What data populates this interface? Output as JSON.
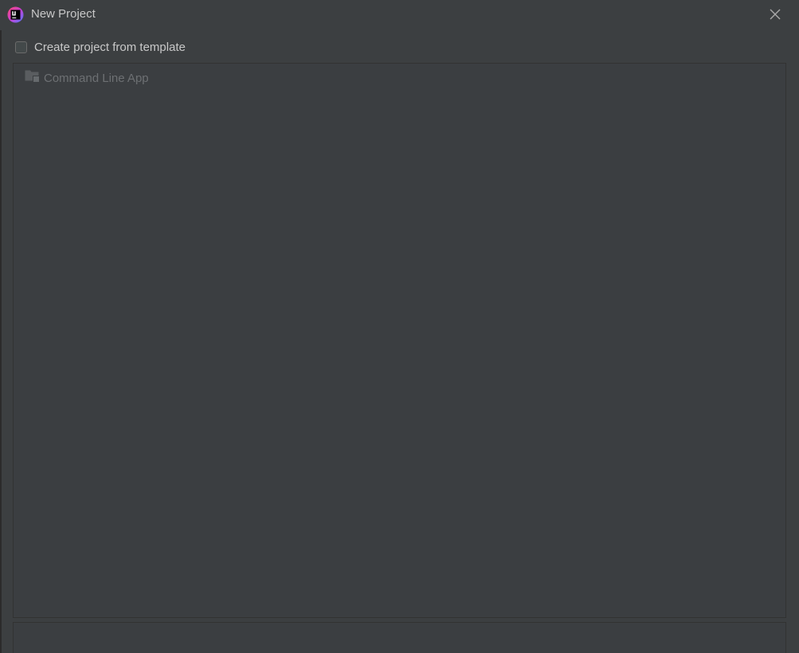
{
  "window": {
    "title": "New Project",
    "app_icon": "intellij-idea-icon",
    "close_icon": "close-icon"
  },
  "template_option": {
    "label": "Create project from template",
    "checked": false
  },
  "templates": {
    "items": [
      {
        "label": "Command Line App",
        "icon": "folder-icon",
        "enabled": false
      }
    ]
  },
  "colors": {
    "background": "#3c3f41",
    "text": "#c8c8c8",
    "disabled_text": "#6d7073"
  }
}
